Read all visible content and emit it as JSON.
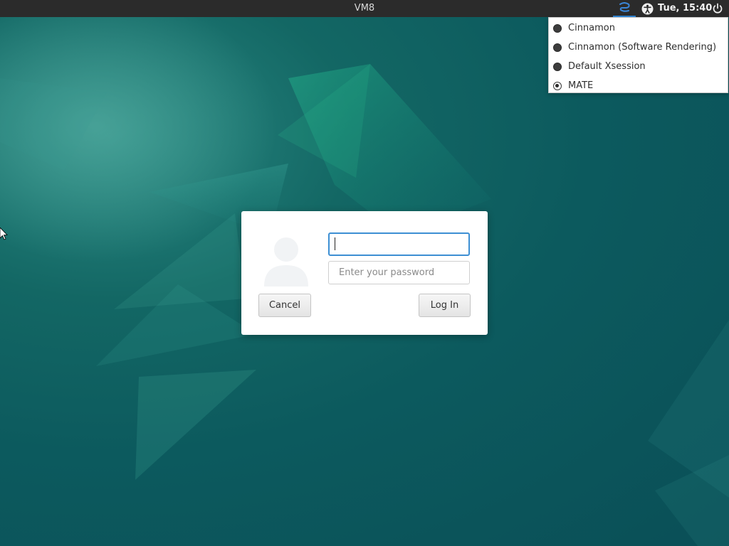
{
  "panel": {
    "hostname": "VM8",
    "clock": "Tue, 15:40",
    "session_icon": "session-icon",
    "accessibility_icon": "accessibility-icon",
    "power_icon": "power-icon"
  },
  "session_menu": {
    "items": [
      {
        "label": "Cinnamon",
        "selected": false
      },
      {
        "label": "Cinnamon (Software Rendering)",
        "selected": false
      },
      {
        "label": "Default Xsession",
        "selected": false
      },
      {
        "label": "MATE",
        "selected": true
      }
    ]
  },
  "login": {
    "username_value": "",
    "password_placeholder": "Enter your password",
    "cancel_label": "Cancel",
    "login_label": "Log In",
    "avatar_icon": "user-avatar-icon"
  },
  "colors": {
    "panel_bg": "#2b2b2b",
    "focus_accent": "#3d8fd3",
    "wallpaper_base": "#0c5a5e",
    "wallpaper_highlight": "#1fa58a"
  }
}
